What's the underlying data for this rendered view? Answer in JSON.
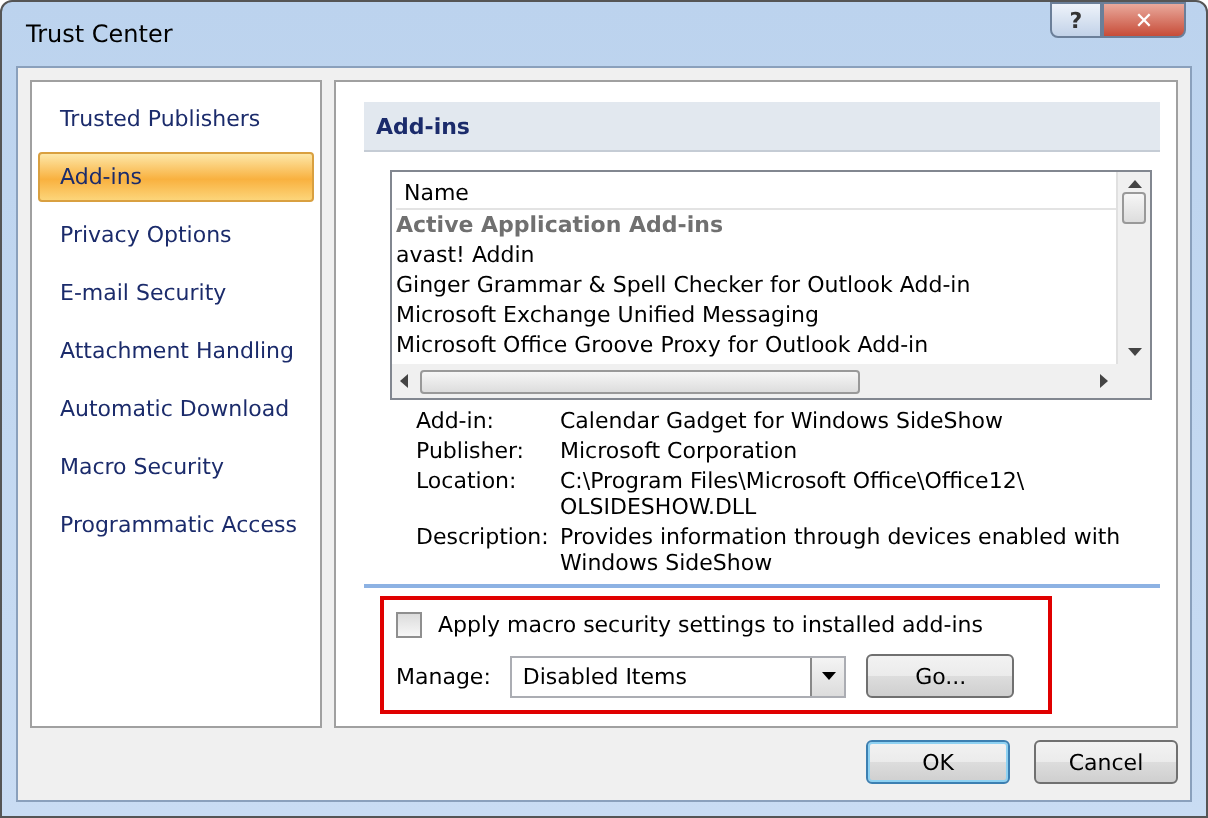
{
  "window": {
    "title": "Trust Center",
    "buttons": [
      "?",
      "✕"
    ]
  },
  "sidebar": {
    "items": [
      {
        "label": "Trusted Publishers",
        "selected": false
      },
      {
        "label": "Add-ins",
        "selected": true
      },
      {
        "label": "Privacy Options",
        "selected": false
      },
      {
        "label": "E-mail Security",
        "selected": false
      },
      {
        "label": "Attachment Handling",
        "selected": false
      },
      {
        "label": "Automatic Download",
        "selected": false
      },
      {
        "label": "Macro Security",
        "selected": false
      },
      {
        "label": "Programmatic Access",
        "selected": false
      }
    ]
  },
  "section": {
    "title": "Add-ins"
  },
  "table": {
    "columns": [
      "Name"
    ],
    "rows": [
      {
        "name": "Active Application Add-ins",
        "kind": "group"
      },
      {
        "name": "avast! Addin",
        "kind": "item"
      },
      {
        "name": "Ginger Grammar & Spell Checker for Outlook Add-in",
        "kind": "item"
      },
      {
        "name": "Microsoft Exchange Unified Messaging",
        "kind": "item"
      },
      {
        "name": "Microsoft Office Groove Proxy for Outlook Add-in",
        "kind": "item"
      }
    ]
  },
  "details": [
    {
      "label": "Add-in:",
      "value": "Calendar Gadget for Windows SideShow"
    },
    {
      "label": "Publisher:",
      "value": "Microsoft Corporation"
    },
    {
      "label": "Location:",
      "value": "C:\\Program Files\\Microsoft Office\\Office12\\ OLSIDESHOW.DLL"
    },
    {
      "label": "Description:",
      "value": "Provides information through devices enabled with Windows SideShow"
    }
  ],
  "macro_checkbox": {
    "label": "Apply macro security settings to installed add-ins",
    "checked": false
  },
  "manage": {
    "label": "Manage:",
    "value": "Disabled Items",
    "button": "Go..."
  },
  "buttons": [
    "OK",
    "Cancel"
  ]
}
